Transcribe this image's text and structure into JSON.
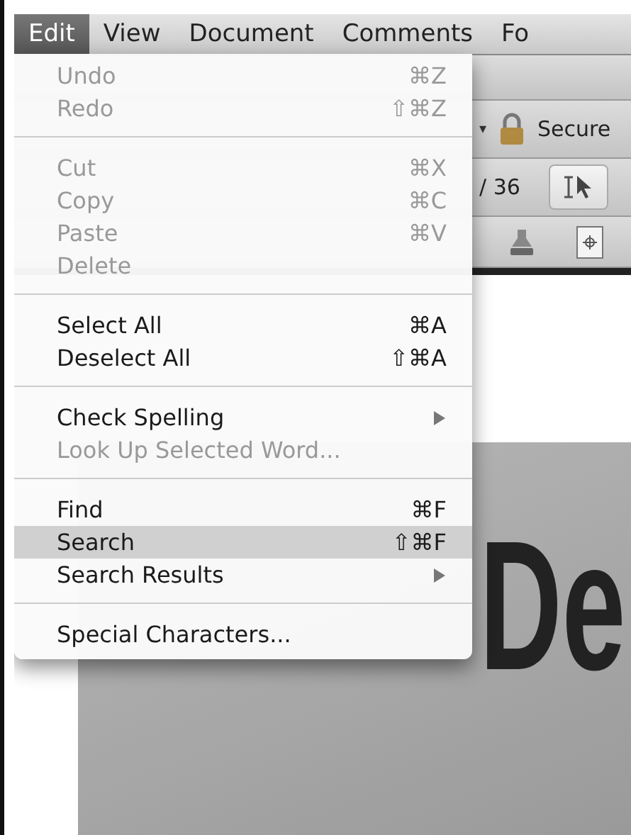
{
  "menu_bar": [
    {
      "label": "Edit",
      "selected": true
    },
    {
      "label": "View",
      "selected": false
    },
    {
      "label": "Document",
      "selected": false
    },
    {
      "label": "Comments",
      "selected": false
    },
    {
      "label": "Fo",
      "selected": false
    }
  ],
  "toolbar": {
    "dropdown_arrow": "▾",
    "security_label": "Secure",
    "page_total": "/ 36"
  },
  "document": {
    "cover_text": "De"
  },
  "edit_menu": {
    "groups": [
      [
        {
          "label": "Undo",
          "shortcut": "⌘Z",
          "disabled": true,
          "selected": false,
          "submenu": false
        },
        {
          "label": "Redo",
          "shortcut": "⇧⌘Z",
          "disabled": true,
          "selected": false,
          "submenu": false
        }
      ],
      [
        {
          "label": "Cut",
          "shortcut": "⌘X",
          "disabled": true,
          "selected": false,
          "submenu": false
        },
        {
          "label": "Copy",
          "shortcut": "⌘C",
          "disabled": true,
          "selected": false,
          "submenu": false
        },
        {
          "label": "Paste",
          "shortcut": "⌘V",
          "disabled": true,
          "selected": false,
          "submenu": false
        },
        {
          "label": "Delete",
          "disabled": true,
          "selected": false,
          "submenu": false
        }
      ],
      [
        {
          "label": "Select All",
          "shortcut": "⌘A",
          "disabled": false,
          "selected": false,
          "submenu": false
        },
        {
          "label": "Deselect All",
          "shortcut": "⇧⌘A",
          "disabled": false,
          "selected": false,
          "submenu": false
        }
      ],
      [
        {
          "label": "Check Spelling",
          "disabled": false,
          "selected": false,
          "submenu": true
        },
        {
          "label": "Look Up Selected Word...",
          "disabled": true,
          "selected": false,
          "submenu": false
        }
      ],
      [
        {
          "label": "Find",
          "shortcut": "⌘F",
          "disabled": false,
          "selected": false,
          "submenu": false
        },
        {
          "label": "Search",
          "shortcut": "⇧⌘F",
          "disabled": false,
          "selected": true,
          "submenu": false
        },
        {
          "label": "Search Results",
          "disabled": false,
          "selected": false,
          "submenu": true
        }
      ],
      [
        {
          "label": "Special Characters...",
          "disabled": false,
          "selected": false,
          "submenu": false
        }
      ]
    ]
  }
}
